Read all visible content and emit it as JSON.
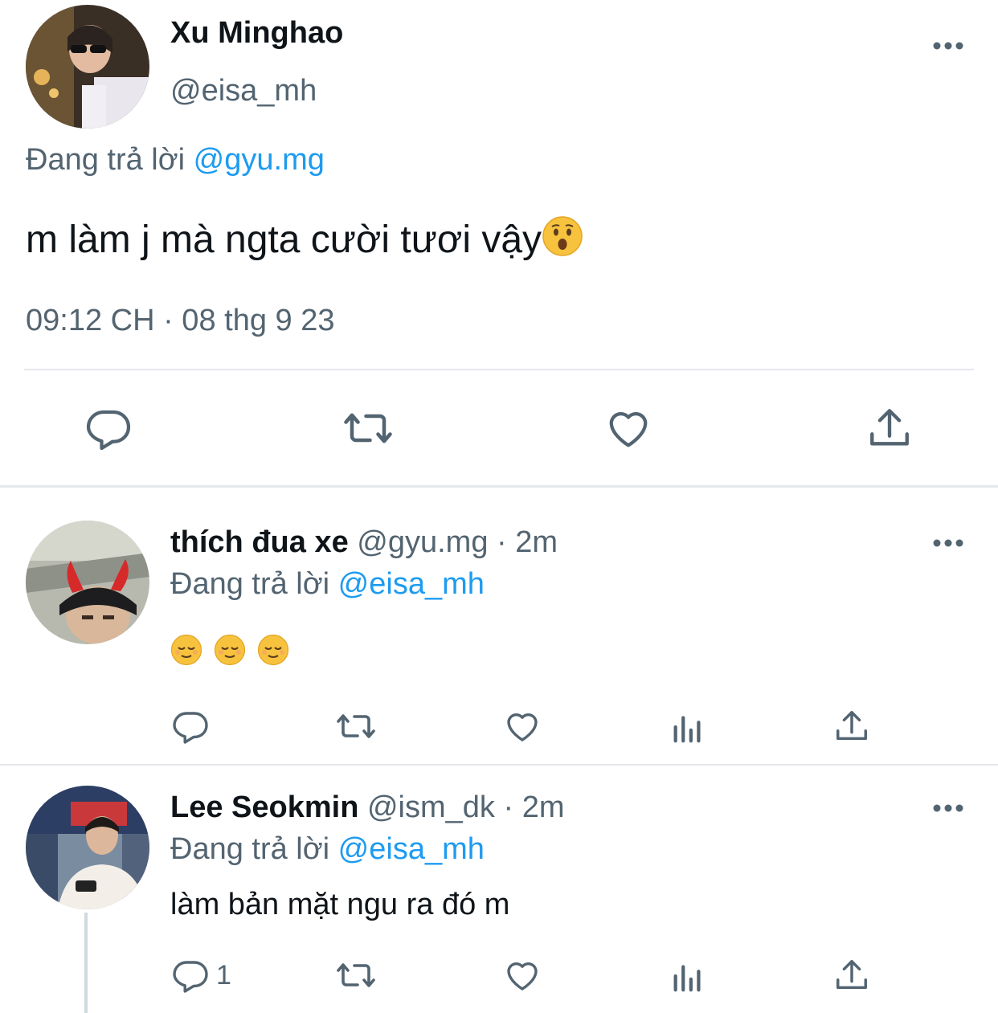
{
  "main_tweet": {
    "display_name": "Xu Minghao",
    "handle": "@eisa_mh",
    "reply_prefix": "Đang trả lời",
    "reply_to": "@gyu.mg",
    "text": "m làm j mà ngta cười tươi vậy",
    "emoji": "hushed-face",
    "timestamp": "09:12 CH · 08 thg 9 23"
  },
  "replies": [
    {
      "display_name": "thích đua xe",
      "handle": "@gyu.mg",
      "time": "· 2m",
      "reply_prefix": "Đang trả lời",
      "reply_to": "@eisa_mh",
      "text": "",
      "emojis": [
        "relieved-face",
        "relieved-face",
        "relieved-face"
      ],
      "reply_count": ""
    },
    {
      "display_name": "Lee Seokmin",
      "handle": "@ism_dk",
      "time": "· 2m",
      "reply_prefix": "Đang trả lời",
      "reply_to": "@eisa_mh",
      "text": "làm bản mặt ngu ra đó m",
      "emojis": [],
      "reply_count": "1"
    }
  ],
  "colors": {
    "accent": "#1d9bf0",
    "muted": "#536471",
    "text": "#0f1419",
    "divider": "#e5e8eb"
  },
  "icons": {
    "reply": "reply-icon",
    "retweet": "retweet-icon",
    "like": "heart-icon",
    "views": "views-icon",
    "share": "share-icon",
    "more": "more-icon"
  }
}
